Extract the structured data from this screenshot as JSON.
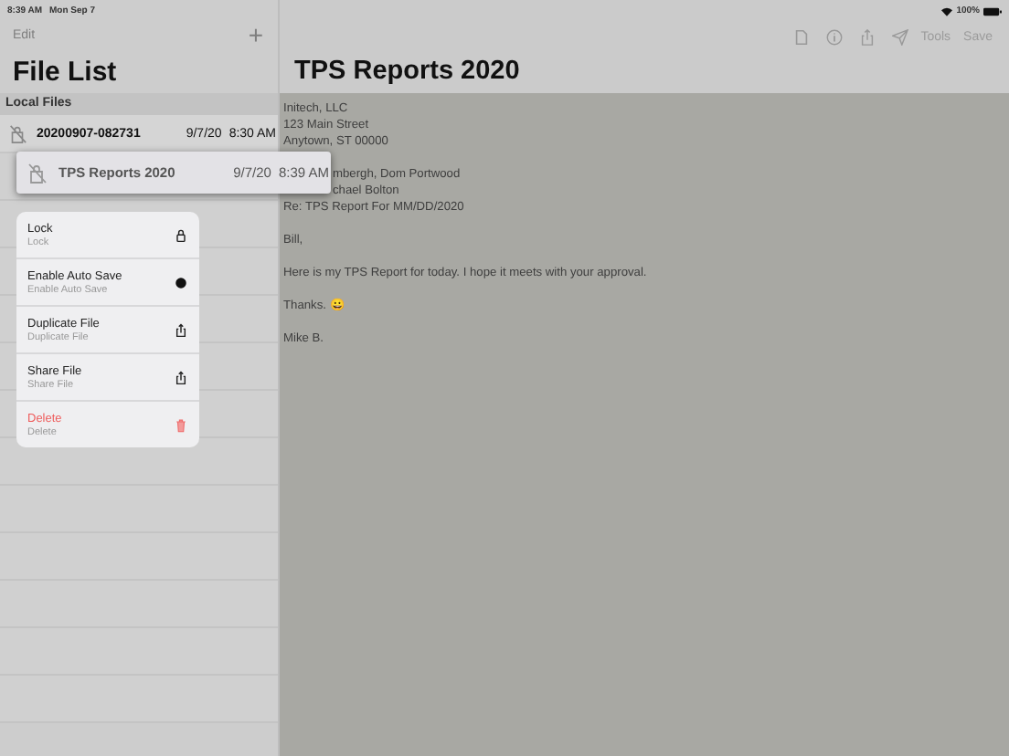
{
  "status_bar": {
    "time": "8:39 AM",
    "date": "Mon Sep 7",
    "battery": "100%"
  },
  "sidebar": {
    "edit": "Edit",
    "add": "+",
    "title": "File List",
    "section": "Local Files",
    "files": [
      {
        "name": "20200907-082731",
        "date": "9/7/20",
        "time": "8:30 AM"
      }
    ],
    "lifted_file": {
      "name": "TPS Reports 2020",
      "date": "9/7/20",
      "time": "8:39 AM"
    }
  },
  "context_menu": [
    {
      "title": "Lock",
      "subtitle": "Lock",
      "kind": "lock",
      "destructive": false
    },
    {
      "title": "Enable Auto Save",
      "subtitle": "Enable Auto Save",
      "kind": "toggle",
      "destructive": false
    },
    {
      "title": "Duplicate File",
      "subtitle": "Duplicate File",
      "kind": "duplicate",
      "destructive": false
    },
    {
      "title": "Share File",
      "subtitle": "Share File",
      "kind": "share",
      "destructive": false
    },
    {
      "title": "Delete",
      "subtitle": "Delete",
      "kind": "delete",
      "destructive": true
    }
  ],
  "document": {
    "title": "TPS Reports 2020",
    "toolbar": [
      "Tools",
      "Save"
    ],
    "paragraphs": [
      [
        {
          "text": "Initech, LLC",
          "kind": "full"
        },
        {
          "text": "123 Main Street",
          "kind": "full"
        },
        {
          "text": "Anytown, ST 00000",
          "kind": "full"
        }
      ],
      [
        {
          "text": "mbergh, Dom Portwood",
          "kind": "partial"
        },
        {
          "text": "chael Bolton",
          "kind": "partial"
        },
        {
          "text": "Re: TPS Report For MM/DD/2020",
          "kind": "full"
        }
      ],
      [
        {
          "text": "Bill,",
          "kind": "full"
        }
      ],
      [
        {
          "text": "Here is my TPS Report for today. I hope it meets with your approval.",
          "kind": "full"
        }
      ],
      [
        {
          "text": "Thanks. 😀",
          "kind": "full"
        }
      ],
      [
        {
          "text": "Mike B.",
          "kind": "full"
        }
      ]
    ]
  }
}
